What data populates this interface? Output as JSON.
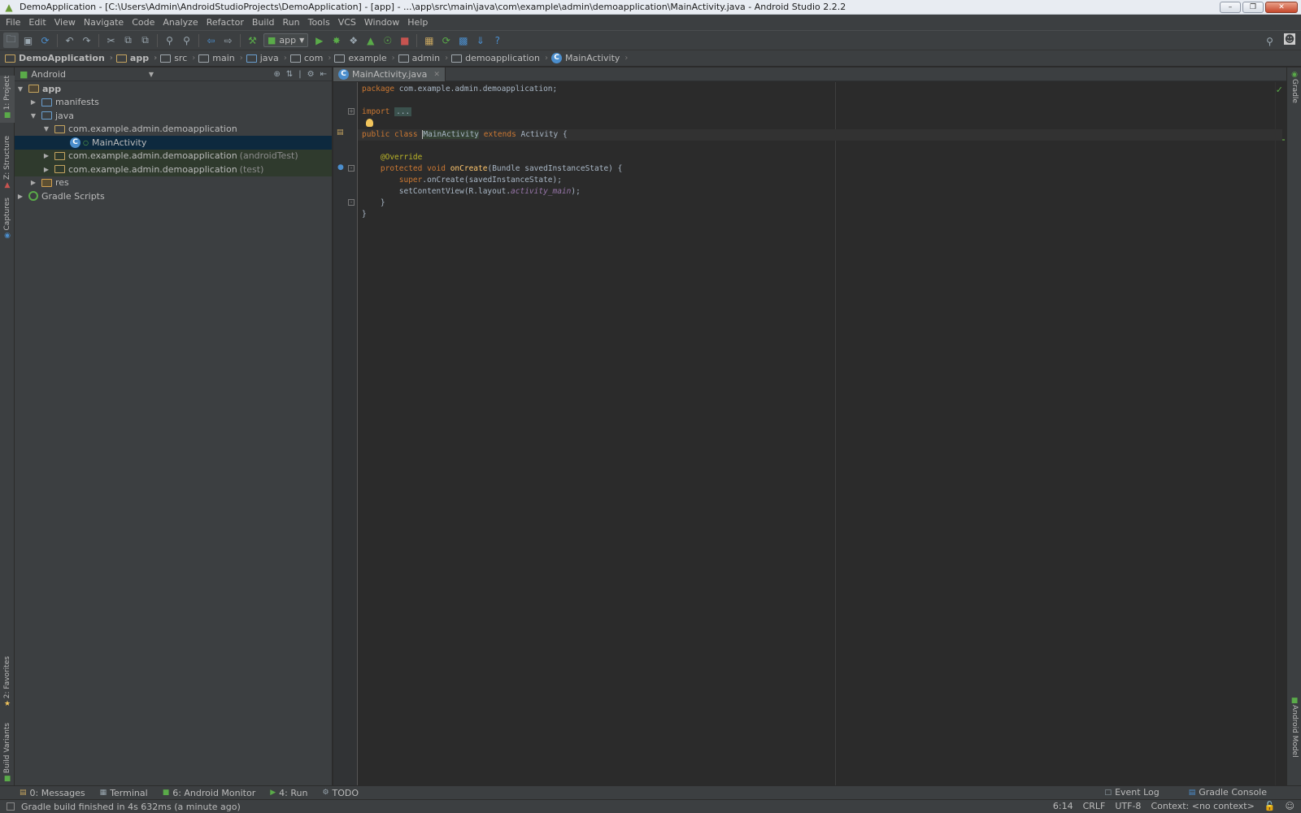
{
  "window": {
    "title": "DemoApplication - [C:\\Users\\Admin\\AndroidStudioProjects\\DemoApplication] - [app] - ...\\app\\src\\main\\java\\com\\example\\admin\\demoapplication\\MainActivity.java - Android Studio 2.2.2",
    "controls": [
      "minimize",
      "restore",
      "close"
    ]
  },
  "menu": [
    "File",
    "Edit",
    "View",
    "Navigate",
    "Code",
    "Analyze",
    "Refactor",
    "Build",
    "Run",
    "Tools",
    "VCS",
    "Window",
    "Help"
  ],
  "toolbar": {
    "run_config": "app",
    "icons": [
      "open-folder-icon",
      "save-icon",
      "sync-icon",
      "undo-icon",
      "redo-icon",
      "cut-icon",
      "copy-icon",
      "paste-icon",
      "find-icon",
      "replace-icon",
      "back-icon",
      "forward-icon",
      "make-project-icon",
      "run-icon",
      "debug-icon",
      "attach-debugger-icon",
      "apply-changes-icon",
      "run-coverage-icon",
      "stop-icon",
      "avd-manager-icon",
      "sync-gradle-icon",
      "project-structure-icon",
      "sdk-manager-icon",
      "help-icon"
    ],
    "search_icon": "search-icon",
    "user_icon": "user-icon"
  },
  "breadcrumbs": [
    "DemoApplication",
    "app",
    "src",
    "main",
    "java",
    "com",
    "example",
    "admin",
    "demoapplication",
    "MainActivity"
  ],
  "left_tool_windows": {
    "top": [
      "1: Project",
      "Z: Structure",
      "Captures"
    ],
    "bottom": [
      "2: Favorites",
      "Build Variants"
    ]
  },
  "right_tool_windows": {
    "top": "Gradle",
    "bottom": "Android Model"
  },
  "project_panel": {
    "view": "Android",
    "tree": [
      {
        "label": "app",
        "suffix": "",
        "expanded": true
      },
      {
        "label": "manifests",
        "suffix": "",
        "expanded": false
      },
      {
        "label": "java",
        "suffix": "",
        "expanded": true
      },
      {
        "label": "com.example.admin.demoapplication",
        "suffix": "",
        "expanded": true
      },
      {
        "label": "MainActivity",
        "suffix": "",
        "expanded": false
      },
      {
        "label": "com.example.admin.demoapplication",
        "suffix": "(androidTest)",
        "expanded": false
      },
      {
        "label": "com.example.admin.demoapplication",
        "suffix": "(test)",
        "expanded": false
      },
      {
        "label": "res",
        "suffix": "",
        "expanded": false
      },
      {
        "label": "Gradle Scripts",
        "suffix": "",
        "expanded": false
      }
    ]
  },
  "editor": {
    "tab": "MainActivity.java",
    "code": {
      "l1_kw": "package",
      "l1_rest": " com.example.admin.demoapplication;",
      "l3_kw": "import",
      "l3_fold": "...",
      "l5_kw": "public class",
      "l5_class": "MainActivity",
      "l5_kw2": "extends",
      "l5_rest": " Activity {",
      "l7_ann": "@Override",
      "l8_kw": "protected void",
      "l8_meth": "onCreate",
      "l8_rest": "(Bundle savedInstanceState) {",
      "l9_kw": "super",
      "l9_rest": ".onCreate(savedInstanceState);",
      "l10_pre": "setContentView(R.layout.",
      "l10_field": "activity_main",
      "l10_post": ");",
      "l11": "}",
      "l12": "}"
    }
  },
  "bottom_tabs": {
    "left": [
      "0: Messages",
      "Terminal",
      "6: Android Monitor",
      "4: Run",
      "TODO"
    ],
    "right": [
      "Event Log",
      "Gradle Console"
    ]
  },
  "status": {
    "message": "Gradle build finished in 4s 632ms (a minute ago)",
    "position": "6:14",
    "line_sep": "CRLF",
    "encoding": "UTF-8",
    "context": "Context: <no context>"
  }
}
